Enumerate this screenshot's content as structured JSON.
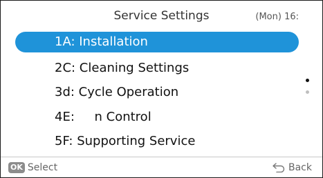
{
  "header": {
    "title": "Service Settings",
    "clock": "(Mon) 16:"
  },
  "menu": {
    "selected_index": 0,
    "items": [
      {
        "label": "1A: Installation"
      },
      {
        "label": "2C: Cleaning Settings"
      },
      {
        "label": "3d: Cycle Operation"
      },
      {
        "label": "4E:     n Control"
      },
      {
        "label": "5F: Supporting Service"
      }
    ]
  },
  "scroll": {
    "pages": 2,
    "current_page": 1
  },
  "footer": {
    "ok_badge": "OK",
    "select_label": "Select",
    "back_label": "Back"
  },
  "colors": {
    "accent": "#1f93d9",
    "background": "#ffffff",
    "text": "#111111",
    "hint_text": "#666666"
  },
  "icons": {
    "back": "back-arrow-icon"
  }
}
